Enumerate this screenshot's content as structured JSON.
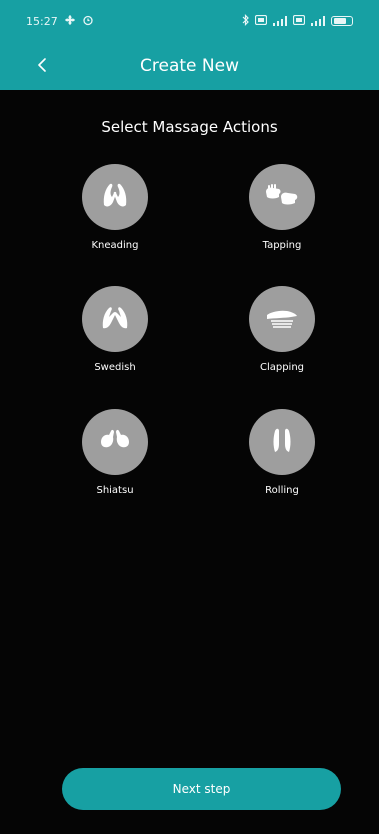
{
  "status_bar": {
    "time": "15:27",
    "icons": [
      "fan-icon",
      "alarm-icon",
      "bluetooth-icon",
      "nfc-icon",
      "signal-icon",
      "signal-icon",
      "battery-icon"
    ]
  },
  "header": {
    "title": "Create New",
    "back_icon": "chevron-left-icon"
  },
  "section_title": "Select Massage Actions",
  "actions": [
    {
      "label": "Kneading",
      "icon": "kneading-hands-icon"
    },
    {
      "label": "Tapping",
      "icon": "tapping-fists-icon"
    },
    {
      "label": "Swedish",
      "icon": "swedish-hands-icon"
    },
    {
      "label": "Clapping",
      "icon": "clapping-hand-icon"
    },
    {
      "label": "Shiatsu",
      "icon": "shiatsu-thumbs-icon"
    },
    {
      "label": "Rolling",
      "icon": "rolling-hands-icon"
    }
  ],
  "next_button": {
    "label": "Next step"
  },
  "colors": {
    "accent": "#17a0a3",
    "background": "#050505",
    "icon_circle": "#9e9e9e"
  }
}
